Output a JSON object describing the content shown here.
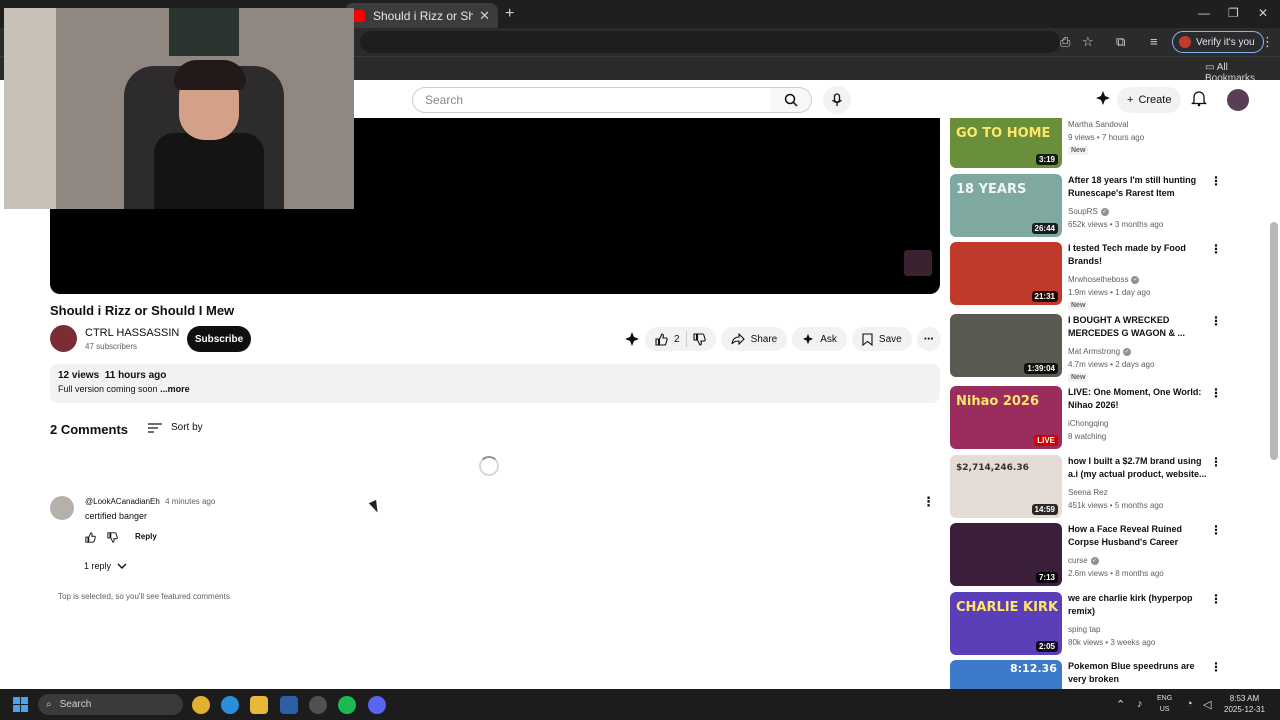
{
  "browser": {
    "tab_title": "Should i Rizz or Should I Mew",
    "tab_close": "✕",
    "new_tab": "+",
    "verify_label": "Verify it's you",
    "all_bookmarks": "All Bookmarks"
  },
  "header": {
    "search_placeholder": "Search",
    "create_label": "Create"
  },
  "video": {
    "title": "Should i Rizz or Should I Mew",
    "channel": "CTRL HASSASSIN",
    "subscribers": "47 subscribers",
    "subscribe_label": "Subscribe",
    "likes": "2",
    "share_label": "Share",
    "ask_label": "Ask",
    "save_label": "Save",
    "views": "12 views",
    "posted": "11 hours ago",
    "description": "Full version coming soon",
    "more_label": "...more"
  },
  "comments": {
    "count_label": "2 Comments",
    "sort_label": "Sort by",
    "items": [
      {
        "author": "@LookACanadianEh",
        "time": "4 minutes ago",
        "text": "certified banger",
        "reply_label": "Reply",
        "replies_label": "1 reply"
      }
    ],
    "footer_note": "Top is selected, so you'll see featured comments"
  },
  "recommendations": [
    {
      "title": "",
      "channel": "Martha Sandoval",
      "verified": false,
      "stats": "9 views • 7 hours ago",
      "badge": "New",
      "duration": "3:19",
      "thumb_text": "GO TO HOME",
      "thumb_color": "#6a8f3a"
    },
    {
      "title": "After 18 years I'm still hunting Runescape's Rarest Item",
      "channel": "SoupRS",
      "verified": true,
      "stats": "652k views • 3 months ago",
      "badge": "",
      "duration": "26:44",
      "thumb_text": "18 YEARS",
      "thumb_color": "#7fa8a0"
    },
    {
      "title": "I tested Tech made by Food Brands!",
      "channel": "Mrwhosetheboss",
      "verified": true,
      "stats": "1.9m views • 1 day ago",
      "badge": "New",
      "duration": "21:31",
      "thumb_text": "",
      "thumb_color": "#c0392b"
    },
    {
      "title": "I BOUGHT A WRECKED MERCEDES G WAGON & ...",
      "channel": "Mat Armstrong",
      "verified": true,
      "stats": "4.7m views • 2 days ago",
      "badge": "New",
      "duration": "1:39:04",
      "thumb_text": "",
      "thumb_color": "#5a5a52"
    },
    {
      "title": "LIVE: One Moment, One World: Nihao 2026!",
      "channel": "iChongqing",
      "verified": false,
      "stats": "8 watching",
      "badge": "",
      "duration": "LIVE",
      "thumb_text": "Nihao 2026",
      "thumb_color": "#9b2c5e"
    },
    {
      "title": "how I built a $2.7M brand using a.i (my actual product, website...",
      "channel": "Seena Rez",
      "verified": false,
      "stats": "451k views • 5 months ago",
      "badge": "",
      "duration": "14:59",
      "thumb_text": "$2,714,246.36",
      "thumb_color": "#e6dcd6"
    },
    {
      "title": "How a Face Reveal Ruined Corpse Husband's Career",
      "channel": "curse",
      "verified": true,
      "stats": "2.6m views • 8 months ago",
      "badge": "",
      "duration": "7:13",
      "thumb_text": "",
      "thumb_color": "#3b1e3a"
    },
    {
      "title": "we are charlie kirk (hyperpop remix)",
      "channel": "sping tap",
      "verified": false,
      "stats": "80k views • 3 weeks ago",
      "badge": "",
      "duration": "2:05",
      "thumb_text": "CHARLIE KIRK",
      "thumb_color": "#5a3fb8"
    },
    {
      "title": "Pokemon Blue speedruns are very broken",
      "channel": "",
      "verified": false,
      "stats": "",
      "badge": "",
      "duration": "",
      "thumb_text": "8:12.36",
      "thumb_color": "#3a7ac9"
    }
  ],
  "taskbar": {
    "search_label": "Search",
    "lang": "ENG",
    "region": "US",
    "time": "8:53 AM",
    "date": "2025-12-31"
  },
  "colors": {
    "subscribe_bg": "#0f0f0f",
    "live_red": "#cc0000",
    "browser_dark": "#1f1f1f"
  }
}
